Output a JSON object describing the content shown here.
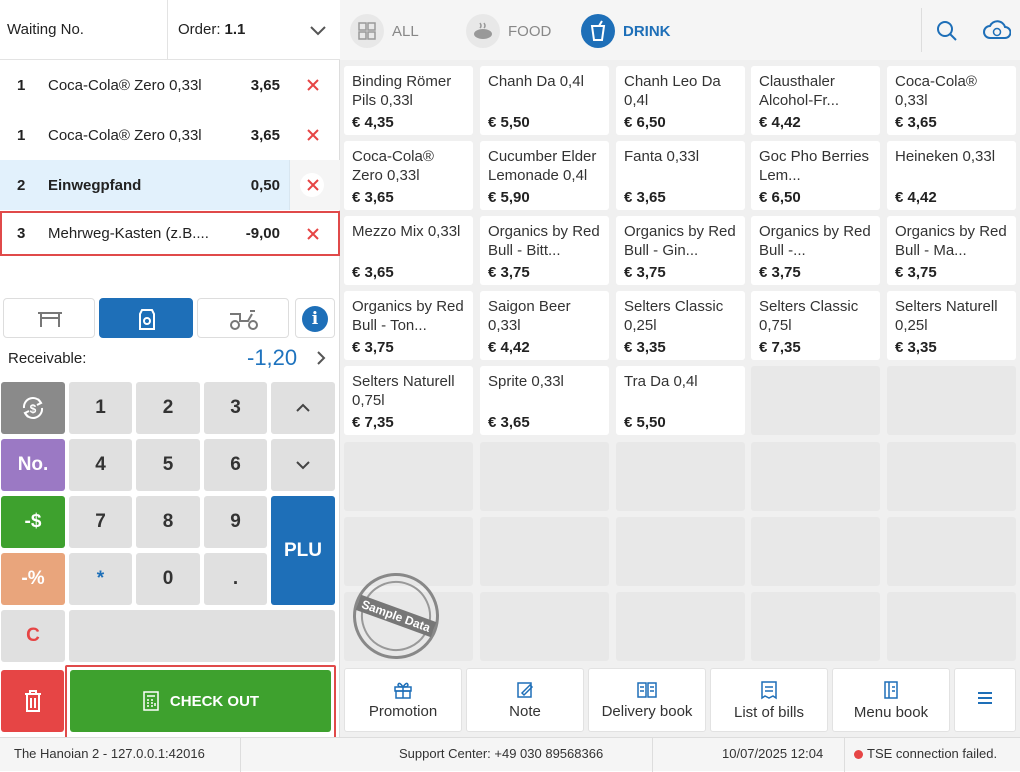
{
  "header": {
    "waiting_label": "Waiting No.",
    "order_label": "Order:",
    "order_value": "1.1"
  },
  "order_items": [
    {
      "qty": "1",
      "name": "Coca-Cola® Zero 0,33l",
      "price": "3,65"
    },
    {
      "qty": "1",
      "name": "Coca-Cola® Zero 0,33l",
      "price": "3,65"
    },
    {
      "qty": "2",
      "name": "Einwegpfand",
      "price": "0,50"
    },
    {
      "qty": "3",
      "name": "Mehrweg-Kasten (z.B....",
      "price": "-9,00"
    }
  ],
  "receivable": {
    "label": "Receivable:",
    "value": "-1,20"
  },
  "keypad": {
    "k1": "1",
    "k2": "2",
    "k3": "3",
    "k4": "4",
    "k5": "5",
    "k6": "6",
    "k7": "7",
    "k8": "8",
    "k9": "9",
    "k0": "0",
    "star": "*",
    "dot": ".",
    "no": "No.",
    "minus_dollar": "-$",
    "minus_percent": "-%",
    "clear": "C",
    "plu": "PLU",
    "checkout": "CHECK OUT"
  },
  "tabs": {
    "all": "ALL",
    "food": "FOOD",
    "drink": "DRINK"
  },
  "products": [
    {
      "name": "Binding Römer Pils 0,33l",
      "price": "€ 4,35"
    },
    {
      "name": "Chanh Da 0,4l",
      "price": "€ 5,50"
    },
    {
      "name": "Chanh Leo Da 0,4l",
      "price": "€ 6,50"
    },
    {
      "name": "Clausthaler Alcohol-Fr...",
      "price": "€ 4,42"
    },
    {
      "name": "Coca-Cola® 0,33l",
      "price": "€ 3,65"
    },
    {
      "name": "Coca-Cola® Zero 0,33l",
      "price": "€ 3,65"
    },
    {
      "name": "Cucumber Elder Lemonade 0,4l",
      "price": "€ 5,90"
    },
    {
      "name": "Fanta 0,33l",
      "price": "€ 3,65"
    },
    {
      "name": "Goc Pho Berries Lem...",
      "price": "€ 6,50"
    },
    {
      "name": "Heineken 0,33l",
      "price": "€ 4,42"
    },
    {
      "name": "Mezzo Mix 0,33l",
      "price": "€ 3,65"
    },
    {
      "name": "Organics by Red Bull - Bitt...",
      "price": "€ 3,75"
    },
    {
      "name": "Organics by Red Bull - Gin...",
      "price": "€ 3,75"
    },
    {
      "name": "Organics by Red Bull -...",
      "price": "€ 3,75"
    },
    {
      "name": "Organics by Red Bull - Ma...",
      "price": "€ 3,75"
    },
    {
      "name": "Organics by Red Bull - Ton...",
      "price": "€ 3,75"
    },
    {
      "name": "Saigon Beer 0,33l",
      "price": "€ 4,42"
    },
    {
      "name": "Selters Classic 0,25l",
      "price": "€ 3,35"
    },
    {
      "name": "Selters Classic 0,75l",
      "price": "€ 7,35"
    },
    {
      "name": "Selters Naturell 0,25l",
      "price": "€ 3,35"
    },
    {
      "name": "Selters Naturell 0,75l",
      "price": "€ 7,35"
    },
    {
      "name": "Sprite 0,33l",
      "price": "€ 3,65"
    },
    {
      "name": "Tra Da 0,4l",
      "price": "€ 5,50"
    }
  ],
  "footer_buttons": {
    "promotion": "Promotion",
    "note": "Note",
    "delivery": "Delivery book",
    "bills": "List of bills",
    "menu": "Menu book"
  },
  "watermark": "Sample Data",
  "status": {
    "server": "The Hanoian 2 - 127.0.0.1:42016",
    "support": "Support Center: +49 030 89568366",
    "datetime": "10/07/2025 12:04",
    "tse": "TSE connection failed."
  },
  "colors": {
    "accent": "#1e6fb8",
    "checkout": "#3ea12e",
    "danger": "#e64545"
  }
}
